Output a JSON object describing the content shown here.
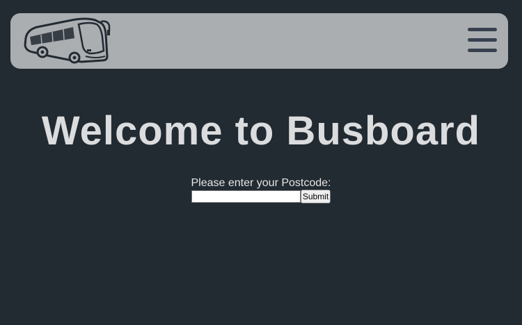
{
  "header": {
    "logo_icon": "bus-icon",
    "menu_icon": "hamburger-menu-icon"
  },
  "main": {
    "title": "Welcome to Busboard",
    "form": {
      "label": "Please enter your Postcode:",
      "postcode_value": "",
      "submit_label": "Submit"
    }
  },
  "colors": {
    "background": "#222a32",
    "navbar": "#abaeb1",
    "title_text": "#dadcde",
    "icon_dark": "#36404f"
  }
}
